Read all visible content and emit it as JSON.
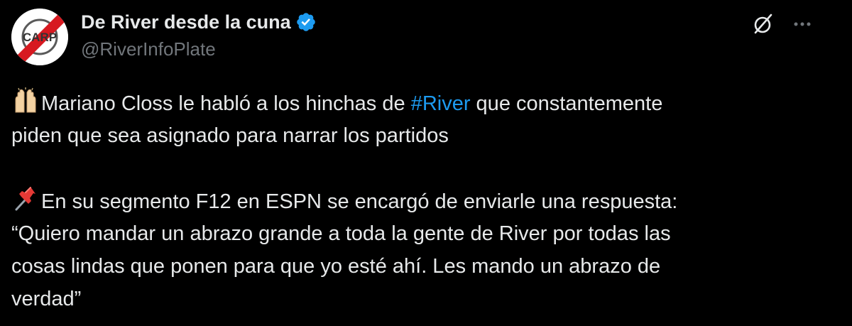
{
  "header": {
    "display_name": "De River desde la cuna",
    "handle": "@RiverInfoPlate",
    "verified": true,
    "avatar_initials": "CARP"
  },
  "actions": {
    "grok_icon": "grok-icon",
    "more_icon": "more-icon"
  },
  "body": {
    "p1_emoji": "raised-hands-icon",
    "p1_line1_before": "Mariano Closs le habló a los hinchas de ",
    "p1_hashtag": "#River",
    "p1_line1_after": " que constantemente",
    "p1_line2": "piden que sea asignado para narrar los partidos",
    "p2_emoji": "pushpin-icon",
    "p2_line1": "En su segmento F12 en ESPN se encargó de enviarle una respuesta:",
    "p2_line2": "“Quiero mandar un abrazo grande a toda la gente de River por todas las",
    "p2_line3": "cosas lindas que ponen para que yo esté ahí. Les mando un abrazo de",
    "p2_line4": "verdad”"
  },
  "colors": {
    "background": "#000000",
    "text": "#e7e9ea",
    "secondary": "#71767b",
    "accent": "#1d9bf0",
    "river_red": "#d71920"
  }
}
